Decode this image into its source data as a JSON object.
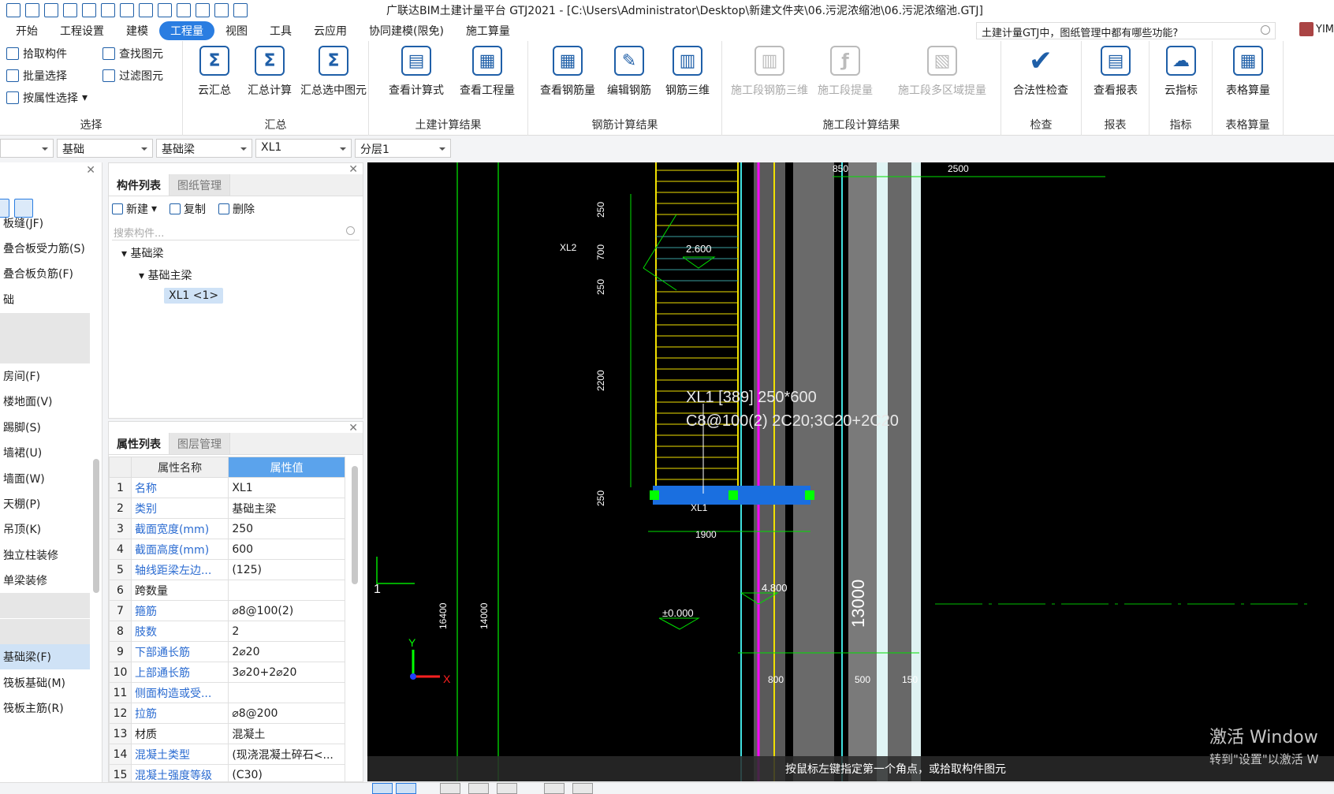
{
  "titlebar": {
    "title": "广联达BIM土建计量平台 GTJ2021 - [C:\\Users\\Administrator\\Desktop\\新建文件夹\\06.污泥浓缩池\\06.污泥浓缩池.GTJ]"
  },
  "menubar": {
    "items": [
      "开始",
      "工程设置",
      "建模",
      "工程量",
      "视图",
      "工具",
      "云应用",
      "协同建模(限免)",
      "施工算量"
    ],
    "active": "工程量",
    "help_search": "土建计量GTJ中，图纸管理中都有哪些功能?",
    "user": "YIM"
  },
  "ribbon": {
    "select": {
      "title": "选择",
      "buttons": [
        "拾取构件",
        "批量选择",
        "按属性选择",
        "查找图元",
        "过滤图元"
      ]
    },
    "summary": {
      "title": "汇总",
      "buttons": [
        "云汇总",
        "汇总计算",
        "汇总选中图元"
      ]
    },
    "civil": {
      "title": "土建计算结果",
      "buttons": [
        "查看计算式",
        "查看工程量"
      ]
    },
    "rebar": {
      "title": "钢筋计算结果",
      "buttons": [
        "查看钢筋量",
        "编辑钢筋",
        "钢筋三维"
      ]
    },
    "construction": {
      "title": "施工段计算结果",
      "buttons": [
        "施工段钢筋三维",
        "施工段提量",
        "施工段多区域提量"
      ]
    },
    "check": {
      "title": "检查",
      "buttons": [
        "合法性检查"
      ]
    },
    "report": {
      "title": "报表",
      "buttons": [
        "查看报表"
      ]
    },
    "index": {
      "title": "指标",
      "buttons": [
        "云指标"
      ]
    },
    "table": {
      "title": "表格算量",
      "buttons": [
        "表格算量"
      ]
    }
  },
  "filterbar": {
    "values": [
      "",
      "基础",
      "基础梁",
      "XL1",
      "分层1"
    ]
  },
  "leftnav": {
    "items": [
      "板缝(JF)",
      "叠合板受力筋(S)",
      "叠合板负筋(F)",
      "础",
      "",
      "",
      "房间(F)",
      "楼地面(V)",
      "踢脚(S)",
      "墙裙(U)",
      "墙面(W)",
      "天棚(P)",
      "吊顶(K)",
      "独立柱装修",
      "单梁装修",
      "",
      "",
      "基础梁(F)",
      "筏板基础(M)",
      "筏板主筋(R)"
    ],
    "selected": "基础梁(F)"
  },
  "component_panel": {
    "tabs": [
      "构件列表",
      "图纸管理"
    ],
    "toolbar": [
      "新建",
      "复制",
      "删除"
    ],
    "search_placeholder": "搜索构件...",
    "tree": {
      "root": "基础梁",
      "child": "基础主梁",
      "leaf": "XL1 <1>"
    }
  },
  "property_panel": {
    "tabs": [
      "属性列表",
      "图层管理"
    ],
    "headers": [
      "",
      "属性名称",
      "属性值"
    ],
    "rows": [
      {
        "n": "1",
        "name": "名称",
        "value": "XL1"
      },
      {
        "n": "2",
        "name": "类别",
        "value": "基础主梁"
      },
      {
        "n": "3",
        "name": "截面宽度(mm)",
        "value": "250"
      },
      {
        "n": "4",
        "name": "截面高度(mm)",
        "value": "600"
      },
      {
        "n": "5",
        "name": "轴线距梁左边...",
        "value": "(125)"
      },
      {
        "n": "6",
        "name": "跨数量",
        "value": ""
      },
      {
        "n": "7",
        "name": "箍筋",
        "value": "⌀8@100(2)"
      },
      {
        "n": "8",
        "name": "肢数",
        "value": "2"
      },
      {
        "n": "9",
        "name": "下部通长筋",
        "value": "2⌀20"
      },
      {
        "n": "10",
        "name": "上部通长筋",
        "value": "3⌀20+2⌀20"
      },
      {
        "n": "11",
        "name": "侧面构造或受...",
        "value": ""
      },
      {
        "n": "12",
        "name": "拉筋",
        "value": "⌀8@200"
      },
      {
        "n": "13",
        "name": "材质",
        "value": "混凝土"
      },
      {
        "n": "14",
        "name": "混凝土类型",
        "value": "(现浇混凝土碎石<..."
      },
      {
        "n": "15",
        "name": "混凝土强度等级",
        "value": "(C30)"
      }
    ]
  },
  "canvas": {
    "dims": {
      "top_left": "850",
      "top_right": "2500",
      "d250a": "250",
      "d700": "700",
      "d250b": "250",
      "d2200": "2200",
      "d250c": "250",
      "d1900": "1900",
      "d16400": "16400",
      "d14000": "14000",
      "d13000": "13000",
      "d800": "800",
      "d500": "500",
      "d150": "150"
    },
    "elevations": [
      "2.600",
      "4.800",
      "±0.000"
    ],
    "labels": {
      "xl2": "XL2",
      "xl1_small": "XL1",
      "axis_one": "1",
      "beam_line1": "XL1 [389] 250*600",
      "beam_line2": "C8@100(2) 2C20;3C20+2C20",
      "axis_x": "X",
      "axis_y": "Y"
    },
    "status_hint": "按鼠标左键指定第一个角点，或拾取构件图元",
    "watermark1": "激活 Window",
    "watermark2": "转到\"设置\"以激活 W"
  },
  "colors": {
    "accent": "#2a7de1",
    "beam": "#1a6fe0",
    "grip": "#00ff00",
    "rebar": "#f0e000",
    "dimension": "#00e000",
    "magenta": "#ff00ff",
    "cyan": "#40e0e0"
  }
}
